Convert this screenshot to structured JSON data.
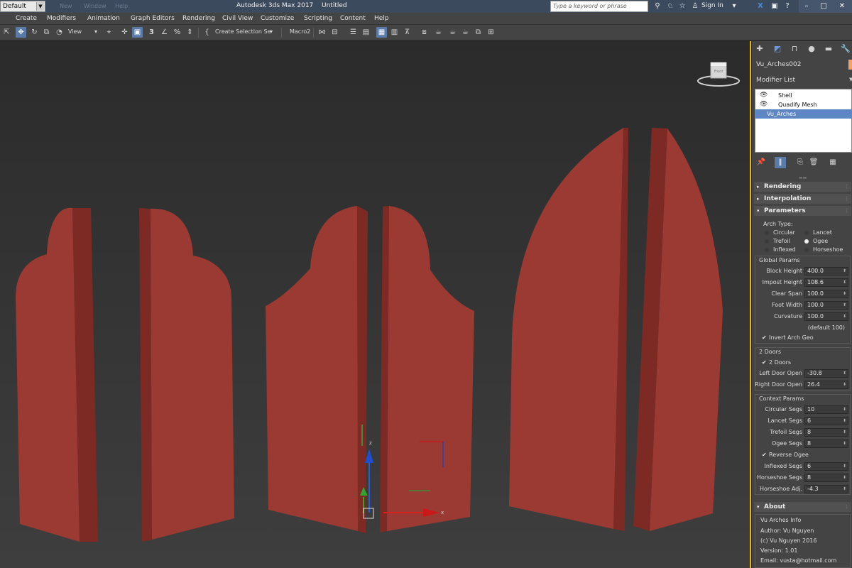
{
  "titlebar": {
    "workspace": "Default",
    "quick_access": [
      "New",
      "Window",
      "Help"
    ],
    "app_title": "Autodesk 3ds Max 2017",
    "doc_title": "Untitled",
    "search_placeholder": "Type a keyword or phrase",
    "sign_in": "Sign In"
  },
  "menu": [
    "Create",
    "Modifiers",
    "Animation",
    "Graph Editors",
    "Rendering",
    "Civil View",
    "Customize",
    "Scripting",
    "Content",
    "Help"
  ],
  "toolbar": {
    "view_label": "View",
    "snap_label": "3",
    "create_selection": "Create Selection Se",
    "macro": "Macro2"
  },
  "viewcube": {
    "label": "Front"
  },
  "gizmo": {
    "x": "x",
    "z": "z"
  },
  "panel": {
    "object_name": "Vu_Arches002",
    "object_color": "#f2a268",
    "modifier_list_label": "Modifier List",
    "stack": [
      {
        "name": "Shell",
        "visible": true,
        "selected": false
      },
      {
        "name": "Quadify Mesh",
        "visible": true,
        "selected": false
      },
      {
        "name": "Vu_Arches",
        "visible": false,
        "selected": true
      }
    ],
    "rollouts": {
      "rendering": "Rendering",
      "interpolation": "Interpolation",
      "parameters": "Parameters",
      "about": "About"
    },
    "arch_type": {
      "title": "Arch Type:",
      "options": [
        {
          "label": "Circular",
          "selected": false
        },
        {
          "label": "Lancet",
          "selected": false
        },
        {
          "label": "Trefoil",
          "selected": false
        },
        {
          "label": "Ogee",
          "selected": true
        },
        {
          "label": "Inflexed",
          "selected": false
        },
        {
          "label": "Horseshoe",
          "selected": false
        }
      ]
    },
    "global_params": {
      "title": "Global Params",
      "fields": [
        {
          "label": "Block Height",
          "value": "400.0"
        },
        {
          "label": "Impost Height",
          "value": "108.6"
        },
        {
          "label": "Clear Span",
          "value": "100.0"
        },
        {
          "label": "Foot Width",
          "value": "100.0"
        },
        {
          "label": "Curvature",
          "value": "100.0"
        }
      ],
      "default_note": "(default 100)",
      "invert_label": "Invert Arch Geo"
    },
    "doors": {
      "title": "2 Doors",
      "check_label": "2 Doors",
      "fields": [
        {
          "label": "Left Door Open",
          "value": "-30.8"
        },
        {
          "label": "Right Door Open",
          "value": "26.4"
        }
      ]
    },
    "context_params": {
      "title": "Context Params",
      "fields_a": [
        {
          "label": "Circular Segs",
          "value": "10"
        },
        {
          "label": "Lancet Segs",
          "value": "6"
        },
        {
          "label": "Trefoil Segs",
          "value": "8"
        },
        {
          "label": "Ogee Segs",
          "value": "8"
        }
      ],
      "reverse_label": "Reverse Ogee",
      "fields_b": [
        {
          "label": "Inflexed Segs",
          "value": "6"
        },
        {
          "label": "Horseshoe Segs",
          "value": "8"
        },
        {
          "label": "Horseshoe Adj.",
          "value": "-4.3"
        }
      ]
    },
    "about": {
      "title": "Vu Arches Info",
      "author": "Author: Vu Nguyen",
      "copyright": "(c) Vu Nguyen 2016",
      "version": "Version: 1.01",
      "email": "Email: vusta@hotmail.com"
    }
  },
  "colors": {
    "door_front": "#9a3a33",
    "door_side": "#7d2a25",
    "accent": "#5c87c4",
    "viewport_border": "#e8b800"
  }
}
